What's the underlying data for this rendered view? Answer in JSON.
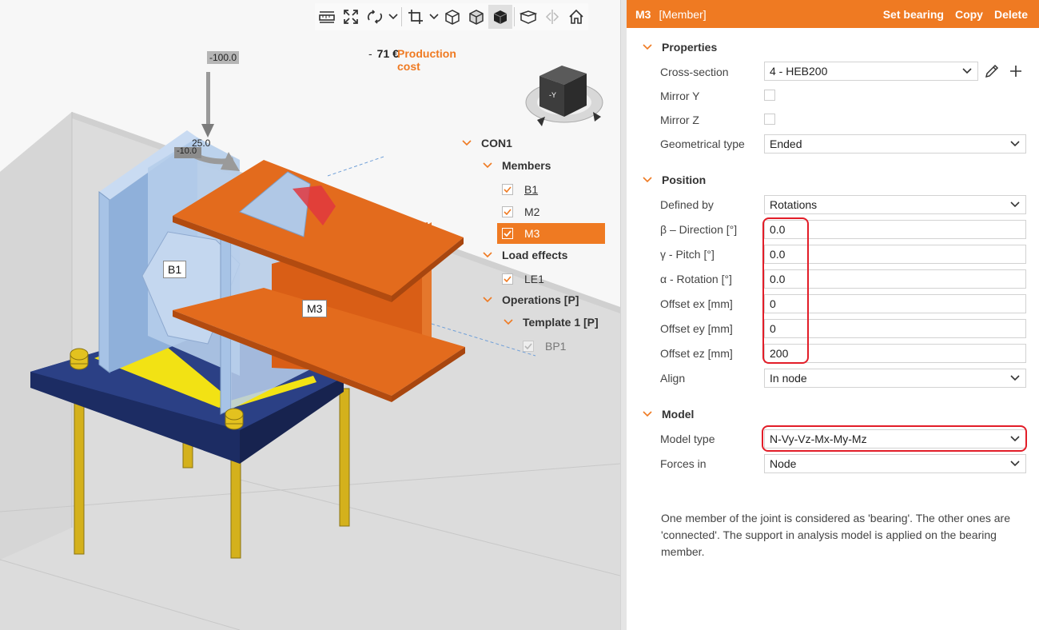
{
  "toolbar": {
    "buttons": [
      {
        "icon": "ruler-icon"
      },
      {
        "icon": "zoom-extents-icon"
      },
      {
        "icon": "rotate-view-icon"
      },
      {
        "icon": "crop-icon"
      },
      {
        "icon": "wireframe-cube-icon"
      },
      {
        "icon": "transparent-cube-icon"
      },
      {
        "icon": "solid-cube-icon",
        "active": true
      },
      {
        "icon": "open-box-icon"
      },
      {
        "icon": "mirror-icon"
      },
      {
        "icon": "home-icon"
      }
    ]
  },
  "viewport": {
    "production_cost_label": "Production cost",
    "production_cost_sep": "-",
    "production_cost_value": "71 €",
    "load_labels": {
      "force": "-100.0",
      "moment": "25.0",
      "small": "-10.0"
    },
    "member_labels": {
      "b1": "B1",
      "m3": "M3"
    },
    "view_cube_face": "-Y",
    "colors": {
      "orange_member": "#d95e16",
      "blue_member": "#a7c3e6",
      "base_plate": "#27397a",
      "anchor": "#d4b11c",
      "weld": "#f2e214"
    }
  },
  "tree": {
    "root": "CON1",
    "members_header": "Members",
    "members": [
      {
        "label": "B1",
        "checked": true,
        "underline": true
      },
      {
        "label": "M2",
        "checked": true
      },
      {
        "label": "M3",
        "checked": true,
        "selected": true
      }
    ],
    "load_effects_header": "Load effects",
    "load_effects": [
      {
        "label": "LE1",
        "checked": true
      }
    ],
    "operations_header": "Operations [P]",
    "template_header": "Template 1 [P]",
    "operations": [
      {
        "label": "BP1",
        "checked": true,
        "disabled": true
      }
    ]
  },
  "panel": {
    "header": {
      "name": "M3",
      "type": "[Member]",
      "actions": [
        "Set bearing",
        "Copy",
        "Delete"
      ]
    },
    "properties": {
      "title": "Properties",
      "cross_section_label": "Cross-section",
      "cross_section_value": "4 - HEB200",
      "mirror_y_label": "Mirror Y",
      "mirror_y": false,
      "mirror_z_label": "Mirror Z",
      "mirror_z": false,
      "geom_type_label": "Geometrical type",
      "geom_type_value": "Ended"
    },
    "position": {
      "title": "Position",
      "defined_by_label": "Defined by",
      "defined_by_value": "Rotations",
      "beta_label": "β – Direction [°]",
      "beta_value": "0.0",
      "gamma_label": "γ - Pitch [°]",
      "gamma_value": "0.0",
      "alpha_label": "α - Rotation [°]",
      "alpha_value": "0.0",
      "ex_label": "Offset ex [mm]",
      "ex_value": "0",
      "ey_label": "Offset ey [mm]",
      "ey_value": "0",
      "ez_label": "Offset ez [mm]",
      "ez_value": "200",
      "align_label": "Align",
      "align_value": "In node"
    },
    "model": {
      "title": "Model",
      "model_type_label": "Model type",
      "model_type_value": "N-Vy-Vz-Mx-My-Mz",
      "forces_in_label": "Forces in",
      "forces_in_value": "Node"
    },
    "note": "One member of the joint is considered as 'bearing'. The other ones are 'connected'. The support in analysis model is applied on the bearing member.",
    "accent_color": "#ef7a22",
    "highlight_color": "#e21d28"
  }
}
